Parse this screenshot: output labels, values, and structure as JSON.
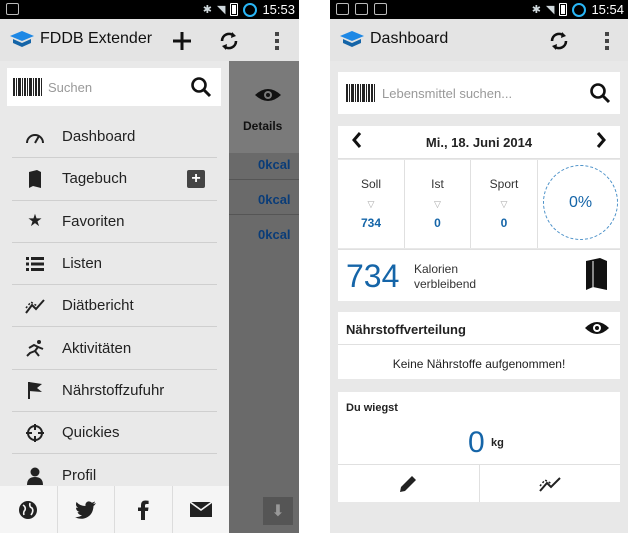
{
  "left": {
    "status": {
      "time": "15:53"
    },
    "actionbar": {
      "title": "FDDB Extender"
    },
    "search": {
      "placeholder": "Suchen"
    },
    "menu": [
      {
        "label": "Dashboard",
        "icon": "gauge-icon"
      },
      {
        "label": "Tagebuch",
        "icon": "book-icon"
      },
      {
        "label": "Favoriten",
        "icon": "star-icon"
      },
      {
        "label": "Listen",
        "icon": "list-icon"
      },
      {
        "label": "Diätbericht",
        "icon": "trend-icon"
      },
      {
        "label": "Aktivitäten",
        "icon": "runner-icon"
      },
      {
        "label": "Nährstoffzufuhr",
        "icon": "flag-icon"
      },
      {
        "label": "Quickies",
        "icon": "crosshair-icon"
      },
      {
        "label": "Profil",
        "icon": "person-icon"
      }
    ],
    "background": {
      "details_label": "Details",
      "kcal_values": [
        "0kcal",
        "0kcal",
        "0kcal"
      ]
    },
    "social": [
      "globe-icon",
      "twitter-icon",
      "facebook-icon",
      "mail-icon"
    ]
  },
  "right": {
    "status": {
      "time": "15:54"
    },
    "actionbar": {
      "title": "Dashboard"
    },
    "search": {
      "placeholder": "Lebensmittel suchen..."
    },
    "date": "Mi., 18. Juni 2014",
    "stats": {
      "soll_label": "Soll",
      "soll_value": "734",
      "ist_label": "Ist",
      "ist_value": "0",
      "sport_label": "Sport",
      "sport_value": "0",
      "percent": "0%"
    },
    "remaining": {
      "value": "734",
      "label_line1": "Kalorien",
      "label_line2": "verbleibend"
    },
    "nutrients": {
      "title": "Nährstoffverteilung",
      "message": "Keine Nährstoffe aufgenommen!"
    },
    "weight": {
      "label": "Du wiegst",
      "value": "0",
      "unit": "kg"
    }
  },
  "colors": {
    "accent": "#1565a8",
    "bar": "#e4e4e4"
  }
}
